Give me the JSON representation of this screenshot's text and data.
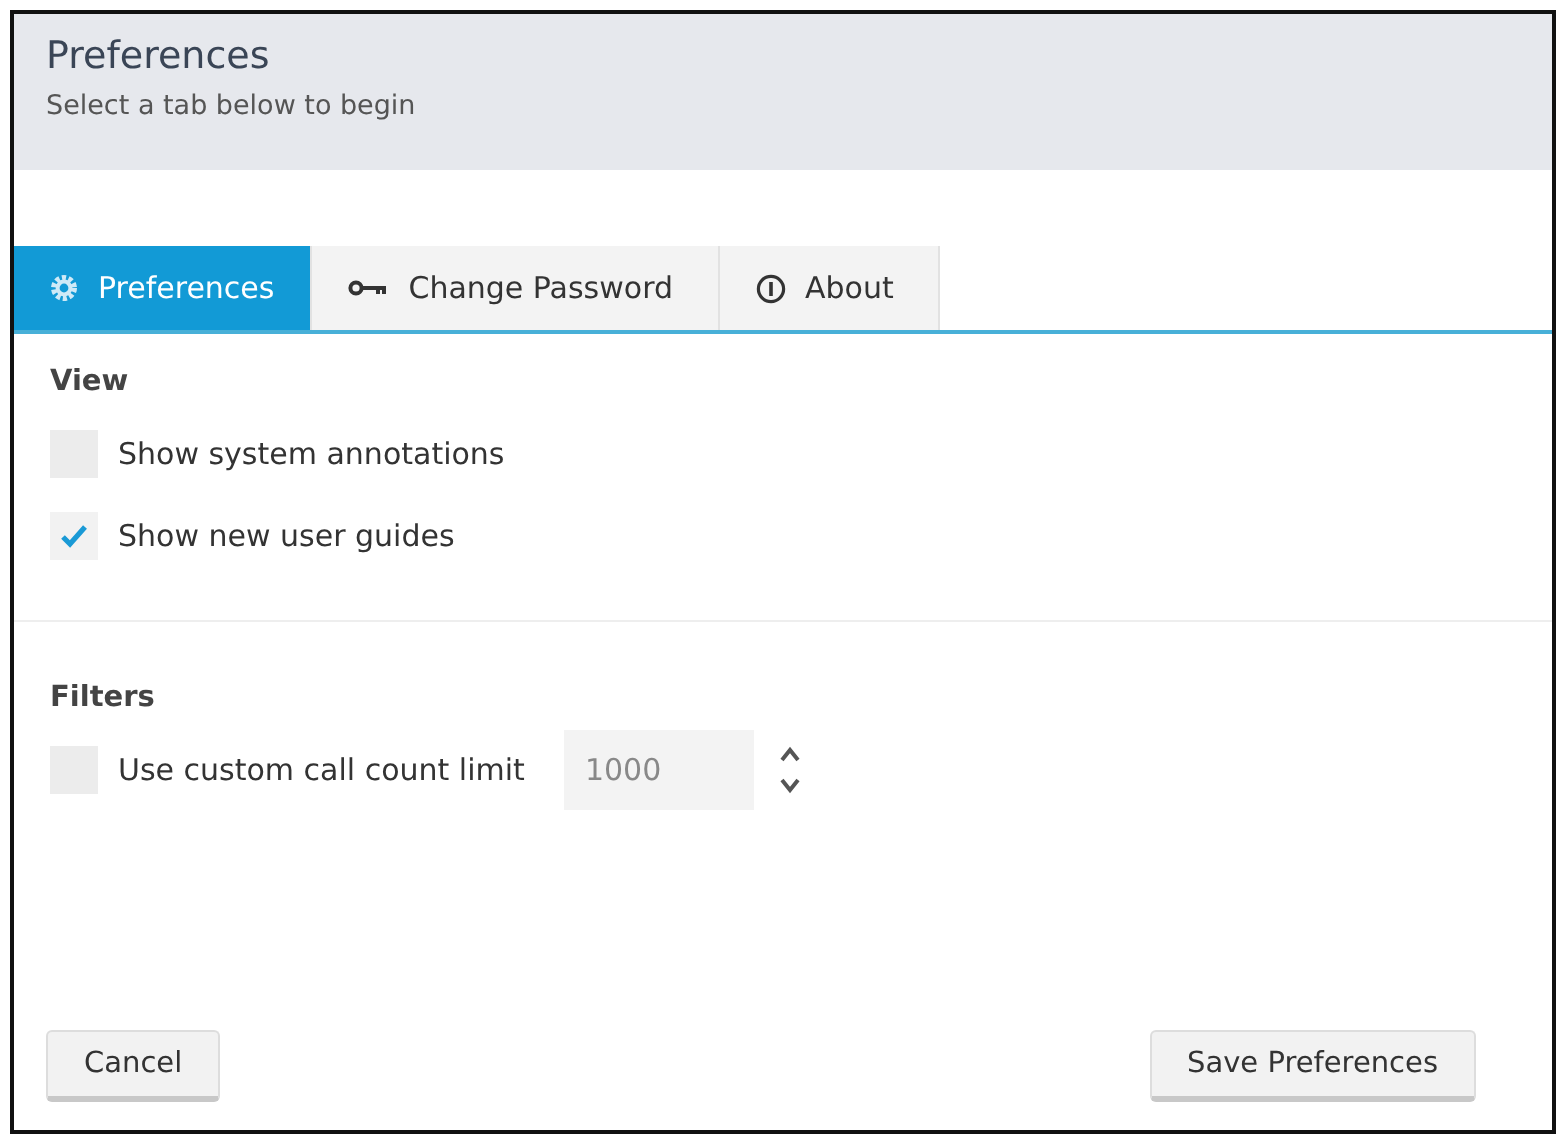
{
  "header": {
    "title": "Preferences",
    "subtitle": "Select a tab below to begin"
  },
  "tabs": [
    {
      "label": "Preferences",
      "selected": true
    },
    {
      "label": "Change Password",
      "selected": false
    },
    {
      "label": "About",
      "selected": false
    }
  ],
  "sections": [
    {
      "title": "View",
      "options": [
        {
          "label": "Show system annotations",
          "checked": false
        },
        {
          "label": "Show new user guides",
          "checked": true
        }
      ]
    },
    {
      "title": "Filters",
      "options": [
        {
          "label": "Use custom call count limit",
          "checked": false,
          "value": "1000"
        }
      ]
    }
  ],
  "buttons": [
    {
      "label": "Cancel"
    },
    {
      "label": "Save Preferences"
    }
  ]
}
